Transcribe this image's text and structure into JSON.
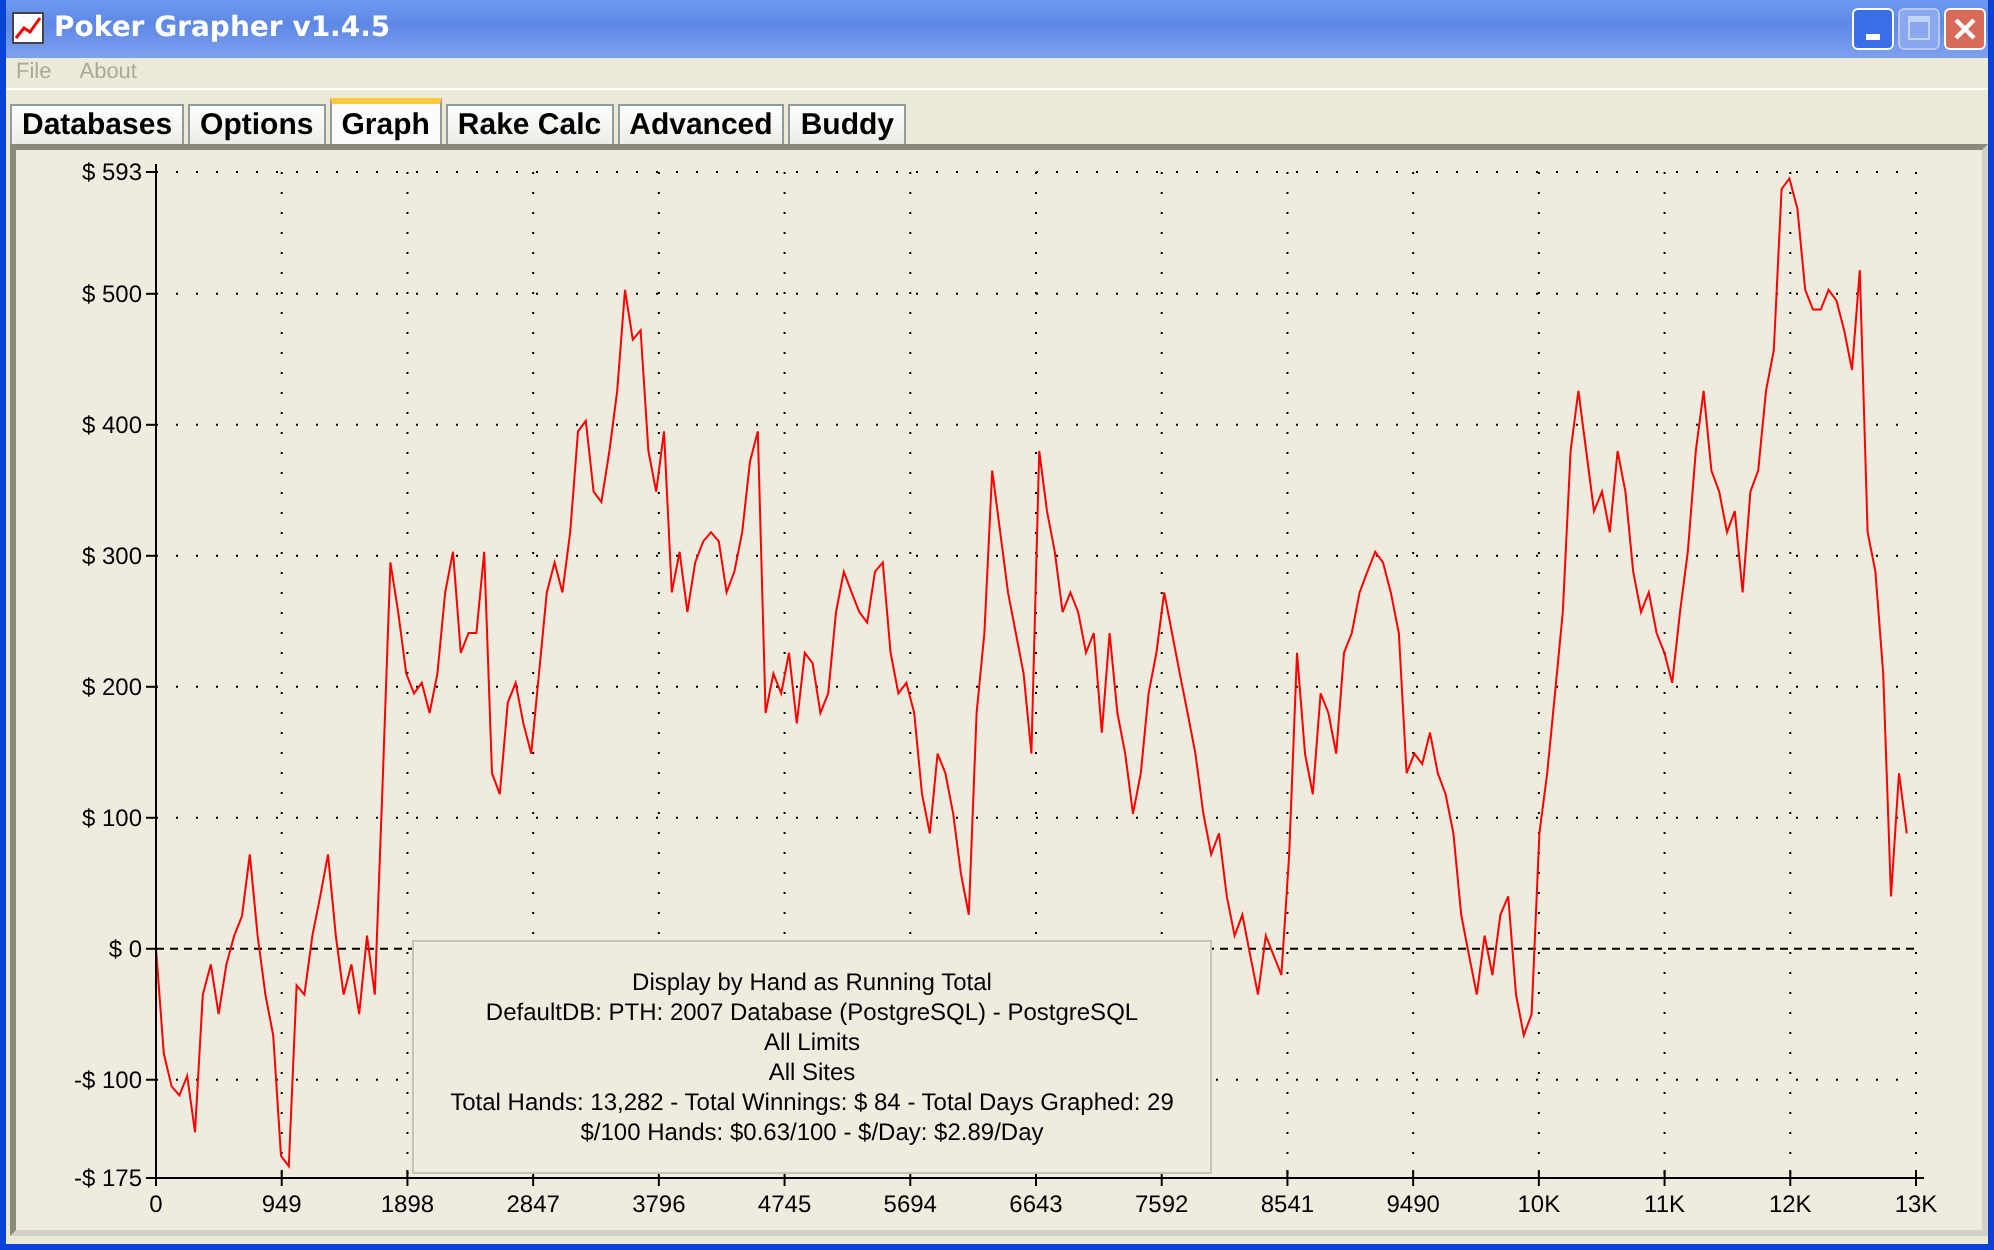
{
  "window": {
    "title": "Poker Grapher v1.4.5"
  },
  "menu": [
    {
      "label": "File",
      "disabled": true
    },
    {
      "label": "About",
      "disabled": true
    }
  ],
  "tabs": [
    {
      "label": "Databases",
      "selected": false
    },
    {
      "label": "Options",
      "selected": false
    },
    {
      "label": "Graph",
      "selected": true
    },
    {
      "label": "Rake Calc",
      "selected": false
    },
    {
      "label": "Advanced",
      "selected": false
    },
    {
      "label": "Buddy",
      "selected": false
    }
  ],
  "graph": {
    "info_box": [
      "Display by Hand as Running Total",
      "DefaultDB: PTH: 2007 Database (PostgreSQL) - PostgreSQL",
      "All Limits",
      "All Sites",
      "Total Hands: 13,282 - Total Winnings: $ 84 - Total Days Graphed: 29",
      "$/100 Hands: $0.63/100 - $/Day: $2.89/Day"
    ],
    "chart_data": {
      "type": "line",
      "grid": true,
      "xlim": [
        0,
        13286
      ],
      "ylim": [
        -175,
        593
      ],
      "xticks": [
        {
          "value": 0,
          "label": "0"
        },
        {
          "value": 949,
          "label": "949"
        },
        {
          "value": 1898,
          "label": "1898"
        },
        {
          "value": 2847,
          "label": "2847"
        },
        {
          "value": 3796,
          "label": "3796"
        },
        {
          "value": 4745,
          "label": "4745"
        },
        {
          "value": 5694,
          "label": "5694"
        },
        {
          "value": 6643,
          "label": "6643"
        },
        {
          "value": 7592,
          "label": "7592"
        },
        {
          "value": 8541,
          "label": "8541"
        },
        {
          "value": 9490,
          "label": "9490"
        },
        {
          "value": 10439,
          "label": "10K"
        },
        {
          "value": 11388,
          "label": "11K"
        },
        {
          "value": 12337,
          "label": "12K"
        },
        {
          "value": 13286,
          "label": "13K"
        }
      ],
      "yticks": [
        {
          "value": -175,
          "label": "-$ 175"
        },
        {
          "value": -100,
          "label": "-$ 100"
        },
        {
          "value": 0,
          "label": "$ 0"
        },
        {
          "value": 100,
          "label": "$ 100"
        },
        {
          "value": 200,
          "label": "$ 200"
        },
        {
          "value": 300,
          "label": "$ 300"
        },
        {
          "value": 400,
          "label": "$ 400"
        },
        {
          "value": 500,
          "label": "$ 500"
        },
        {
          "value": 593,
          "label": "$ 593"
        }
      ],
      "x": [
        0,
        59,
        118,
        177,
        236,
        295,
        354,
        413,
        472,
        531,
        590,
        649,
        708,
        767,
        826,
        885,
        944,
        1003,
        1062,
        1121,
        1180,
        1239,
        1298,
        1357,
        1416,
        1475,
        1534,
        1593,
        1652,
        1711,
        1770,
        1829,
        1888,
        1947,
        2006,
        2065,
        2124,
        2183,
        2242,
        2301,
        2360,
        2419,
        2478,
        2537,
        2596,
        2655,
        2714,
        2773,
        2832,
        2891,
        2950,
        3009,
        3068,
        3127,
        3186,
        3245,
        3304,
        3363,
        3422,
        3481,
        3540,
        3599,
        3658,
        3717,
        3776,
        3835,
        3894,
        3953,
        4012,
        4071,
        4130,
        4189,
        4248,
        4307,
        4366,
        4425,
        4484,
        4543,
        4602,
        4661,
        4720,
        4779,
        4838,
        4897,
        4956,
        5015,
        5074,
        5133,
        5192,
        5251,
        5310,
        5369,
        5428,
        5487,
        5546,
        5605,
        5664,
        5723,
        5782,
        5841,
        5900,
        5959,
        6018,
        6077,
        6136,
        6195,
        6254,
        6313,
        6372,
        6431,
        6490,
        6549,
        6608,
        6667,
        6726,
        6785,
        6844,
        6903,
        6962,
        7021,
        7080,
        7139,
        7198,
        7257,
        7316,
        7375,
        7434,
        7493,
        7552,
        7611,
        7670,
        7729,
        7788,
        7847,
        7906,
        7965,
        8024,
        8083,
        8142,
        8201,
        8260,
        8319,
        8378,
        8437,
        8496,
        8555,
        8614,
        8673,
        8732,
        8791,
        8850,
        8909,
        8968,
        9027,
        9086,
        9145,
        9204,
        9263,
        9322,
        9381,
        9440,
        9499,
        9558,
        9617,
        9676,
        9735,
        9794,
        9853,
        9912,
        9971,
        10030,
        10089,
        10148,
        10207,
        10266,
        10325,
        10384,
        10443,
        10502,
        10561,
        10620,
        10679,
        10738,
        10797,
        10856,
        10915,
        10974,
        11033,
        11092,
        11151,
        11210,
        11269,
        11328,
        11387,
        11446,
        11505,
        11564,
        11623,
        11682,
        11741,
        11800,
        11859,
        11918,
        11977,
        12036,
        12095,
        12154,
        12213,
        12272,
        12331,
        12390,
        12449,
        12508,
        12567,
        12626,
        12685,
        12744,
        12803,
        12862,
        12921,
        12980,
        13039,
        13098,
        13157,
        13216
      ],
      "series": [
        {
          "color": "#ff0000",
          "values": [
            0,
            -80,
            -105,
            -112,
            -97,
            -140,
            -35,
            -12,
            -50,
            -12,
            10,
            25,
            72,
            10,
            -35,
            -66,
            -158,
            -166,
            -28,
            -35,
            10,
            40,
            72,
            10,
            -35,
            -12,
            -50,
            10,
            -35,
            126,
            295,
            257,
            210,
            195,
            203,
            180,
            210,
            272,
            303,
            226,
            241,
            241,
            303,
            134,
            118,
            188,
            203,
            172,
            149,
            210,
            272,
            295,
            272,
            318,
            395,
            403,
            349,
            341,
            380,
            426,
            503,
            465,
            472,
            380,
            349,
            395,
            272,
            303,
            257,
            295,
            311,
            318,
            311,
            272,
            288,
            318,
            372,
            395,
            180,
            210,
            195,
            226,
            172,
            226,
            218,
            180,
            195,
            257,
            288,
            272,
            257,
            249,
            288,
            295,
            226,
            195,
            203,
            180,
            118,
            88,
            149,
            134,
            103,
            57,
            26,
            180,
            241,
            365,
            318,
            272,
            241,
            210,
            149,
            380,
            334,
            303,
            257,
            272,
            257,
            226,
            241,
            165,
            241,
            180,
            149,
            103,
            134,
            195,
            226,
            272,
            241,
            210,
            180,
            149,
            103,
            72,
            88,
            40,
            10,
            26,
            -5,
            -35,
            10,
            -5,
            -20,
            72,
            226,
            149,
            118,
            195,
            180,
            149,
            226,
            241,
            272,
            288,
            303,
            295,
            272,
            241,
            134,
            149,
            141,
            165,
            134,
            118,
            88,
            26,
            -5,
            -35,
            10,
            -20,
            26,
            40,
            -35,
            -66,
            -50,
            88,
            134,
            195,
            257,
            380,
            426,
            380,
            334,
            349,
            318,
            380,
            349,
            288,
            257,
            272,
            241,
            226,
            203,
            257,
            303,
            380,
            426,
            365,
            349,
            318,
            334,
            272,
            349,
            365,
            426,
            457,
            580,
            588,
            565,
            503,
            488,
            488,
            503,
            495,
            472,
            442,
            518,
            318,
            288,
            210,
            40,
            134,
            88
          ]
        }
      ]
    }
  }
}
